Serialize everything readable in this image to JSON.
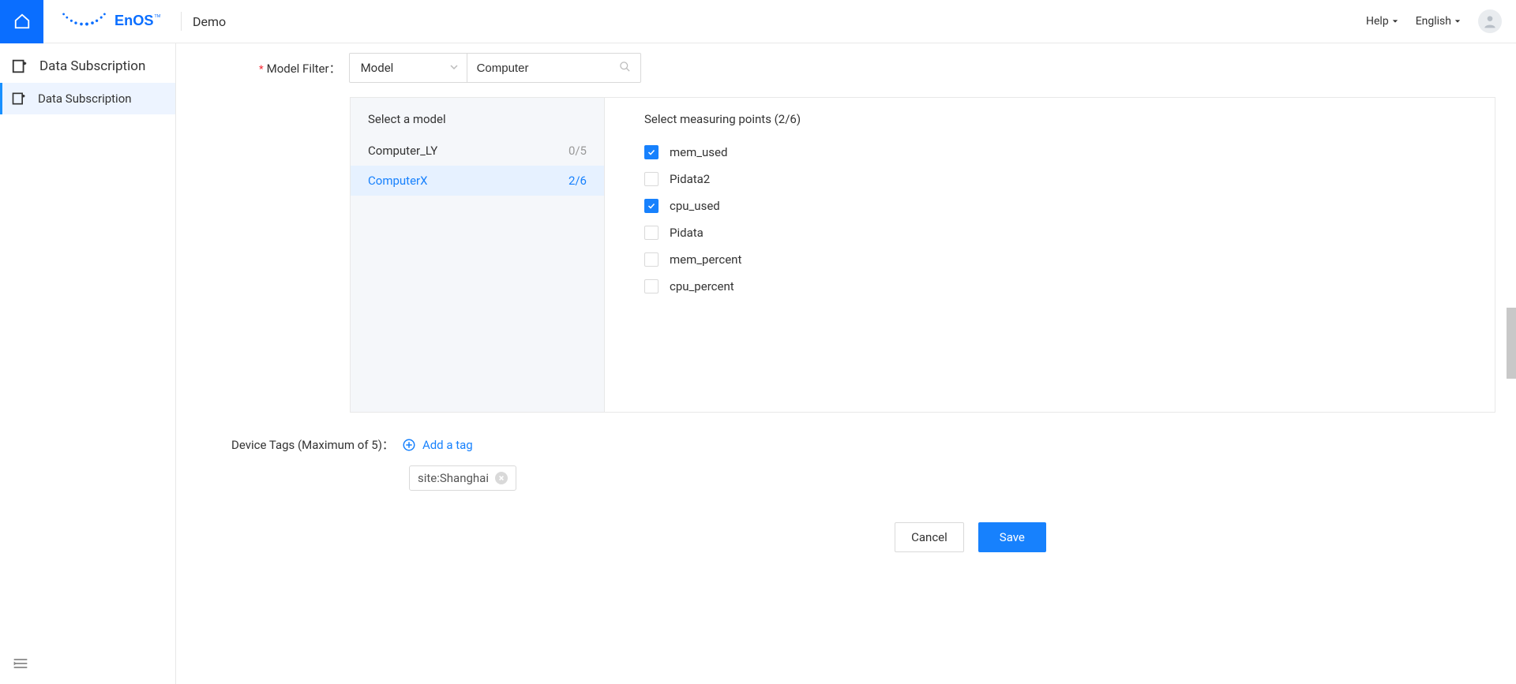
{
  "header": {
    "org": "Demo",
    "help": "Help",
    "language": "English"
  },
  "sidebar": {
    "group_title": "Data Subscription",
    "items": [
      "Data Subscription"
    ]
  },
  "filter": {
    "label": "Model Filter：",
    "select_value": "Model",
    "search_value": "Computer"
  },
  "panel": {
    "left_title": "Select a model",
    "models": [
      {
        "name": "Computer_LY",
        "count": "0/5",
        "selected": false
      },
      {
        "name": "ComputerX",
        "count": "2/6",
        "selected": true
      }
    ],
    "right_title": "Select measuring points (2/6)",
    "points": [
      {
        "label": "mem_used",
        "checked": true
      },
      {
        "label": "Pidata2",
        "checked": false
      },
      {
        "label": "cpu_used",
        "checked": true
      },
      {
        "label": "Pidata",
        "checked": false
      },
      {
        "label": "mem_percent",
        "checked": false
      },
      {
        "label": "cpu_percent",
        "checked": false
      }
    ]
  },
  "tags": {
    "label": "Device Tags (Maximum of 5)：",
    "add": "Add a tag",
    "items": [
      "site:Shanghai"
    ]
  },
  "buttons": {
    "cancel": "Cancel",
    "save": "Save"
  }
}
